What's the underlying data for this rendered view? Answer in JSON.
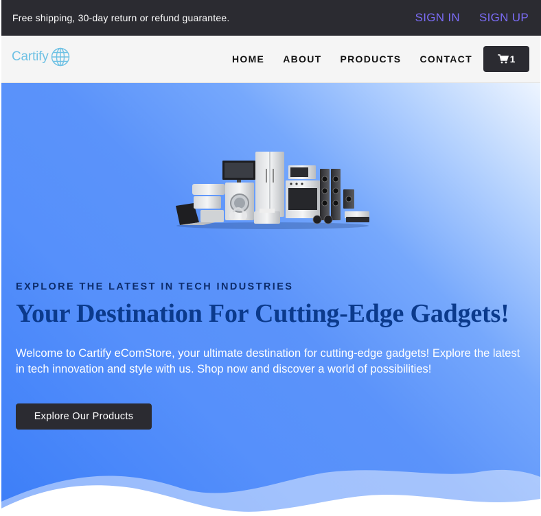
{
  "topbar": {
    "promo": "Free shipping, 30-day return or refund guarantee.",
    "sign_in": "SIGN IN",
    "sign_up": "SIGN UP",
    "auth_color": "#7b6cf6"
  },
  "nav": {
    "logo_text": "Cartify",
    "logo_icon": "globe-icon",
    "links": [
      "HOME",
      "ABOUT",
      "PRODUCTS",
      "CONTACT"
    ],
    "cart_icon": "cart-icon",
    "cart_count": "1"
  },
  "hero": {
    "image_icon": "electronics-appliances-image",
    "eyebrow": "EXPLORE THE LATEST IN TECH INDUSTRIES",
    "headline": "Your Destination For Cutting-Edge Gadgets!",
    "intro": "Welcome to Cartify eComStore, your ultimate destination for cutting-edge gadgets! Explore the latest in tech innovation and style with us. Shop now and discover a world of possibilities!",
    "cta_label": "Explore Our Products",
    "headline_color": "#0b3a8c",
    "bg_color": "#5690fb"
  }
}
